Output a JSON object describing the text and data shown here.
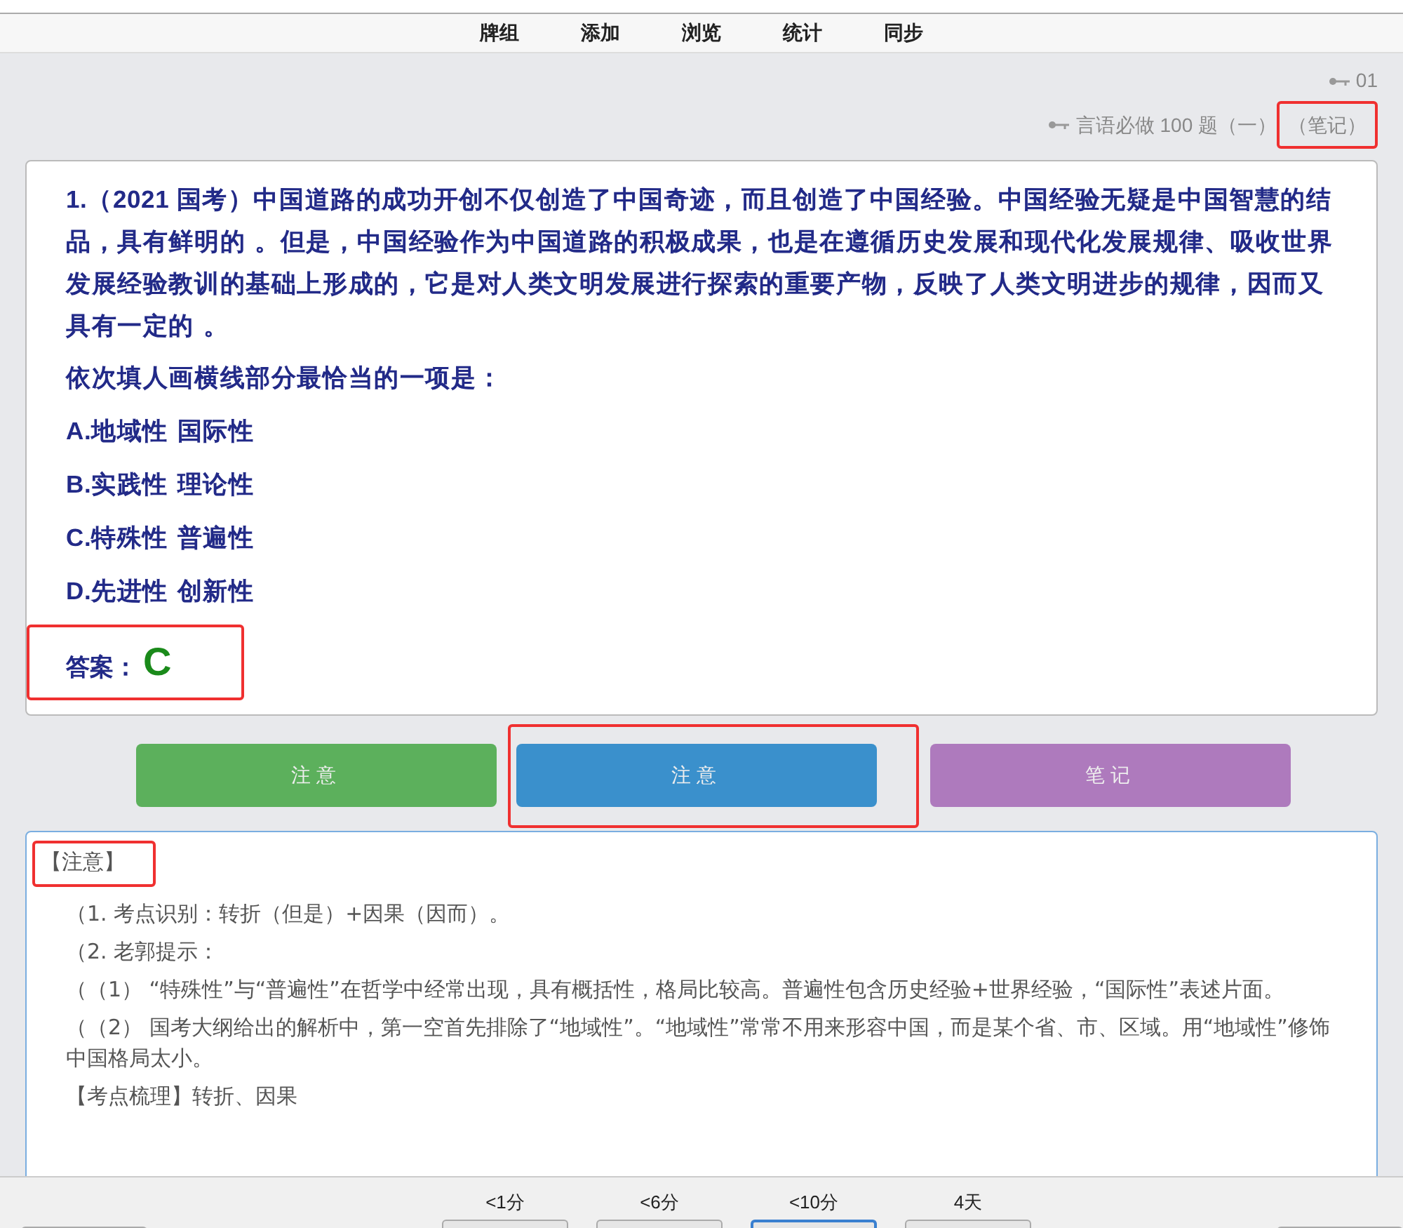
{
  "nav": {
    "tabs": [
      {
        "label": "牌组",
        "selected": false
      },
      {
        "label": "添加",
        "selected": false
      },
      {
        "label": "浏览",
        "selected": false
      },
      {
        "label": "统计",
        "selected": false
      },
      {
        "label": "同步",
        "selected": false
      }
    ]
  },
  "header": {
    "deck_id": "01",
    "deck_name": "言语必做 100 题（一）",
    "field": "（笔记）",
    "field_highlighted": true
  },
  "question": {
    "number": "1.（2021 国考）",
    "stem": "中国道路的成功开创不仅创造了中国奇迹，而且创造了中国经验。中国经验无疑是中国智慧的结品，具有鲜明的 。但是，中国经验作为中国道路的积极成果，也是在遵循历史发展和现代化发展规律、吸收世界发展经验教训的基础上形成的，它是对人类文明发展进行探索的重要产物，反映了人类文明进步的规律，因而又具有一定的 。",
    "prompt": "依次填人画横线部分最恰当的一项是：",
    "options": [
      {
        "letter": "A.",
        "text": "地域性 国际性"
      },
      {
        "letter": "B.",
        "text": "实践性 理论性"
      },
      {
        "letter": "C.",
        "text": "特殊性 普遍性"
      },
      {
        "letter": "D.",
        "text": "先进性 创新性"
      }
    ],
    "answer_label": "答案：",
    "answer": "C",
    "answer_highlighted": true
  },
  "buttons": [
    {
      "label": "注意",
      "color": "#5cb05c",
      "highlighted": false
    },
    {
      "label": "注意",
      "color": "#3a90cc",
      "highlighted": true
    },
    {
      "label": "笔记",
      "color": "#ae7abd",
      "highlighted": false
    }
  ],
  "notes": {
    "heading": "【注意】",
    "heading_highlighted": true,
    "paragraphs": [
      "（1. 考点识别：转折（但是）+因果（因而）。",
      "（2. 老郭提示：",
      "（（1） “特殊性”与“普遍性”在哲学中经常出现，具有概括性，格局比较高。普遍性包含历史经验+世界经验，“国际性”表述片面。",
      "（（2） 国考大纲给出的解析中，第一空首先排除了“地域性”。“地域性”常常不用来形容中国，而是某个省、市、区域。用“地域性”修饰中国格局太小。",
      "【考点梳理】转折、因果"
    ]
  },
  "bottom_bar": {
    "intervals": [
      {
        "label": "<1分",
        "selected": false
      },
      {
        "label": "<6分",
        "selected": false
      },
      {
        "label": "<10分",
        "selected": true
      },
      {
        "label": "4天",
        "selected": false
      }
    ]
  }
}
